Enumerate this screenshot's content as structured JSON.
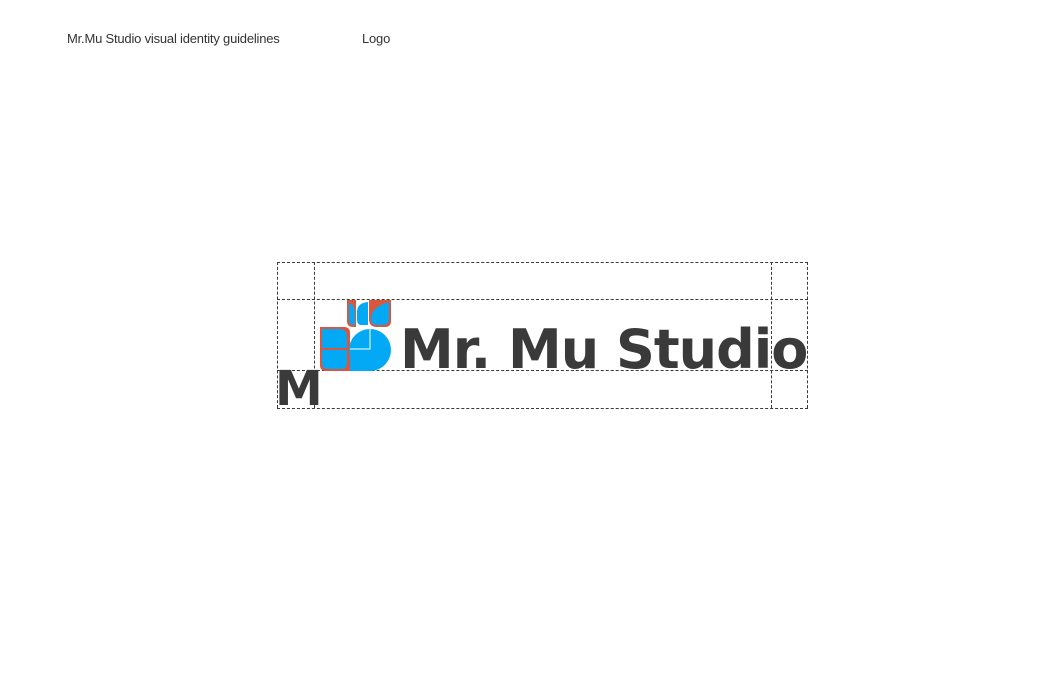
{
  "header": {
    "doc_title": "Mr.Mu Studio visual identity guidelines",
    "section_label": "Logo"
  },
  "logo": {
    "wordmark": "Mr. Mu Studio",
    "clearspace_unit": "M",
    "colors": {
      "mark_blue": "#03a9f4",
      "mark_outline": "#d9573f",
      "text": "#3a3a3a",
      "guide": "#3a3a3a"
    },
    "icon": "leaf-circle-mark-icon"
  }
}
